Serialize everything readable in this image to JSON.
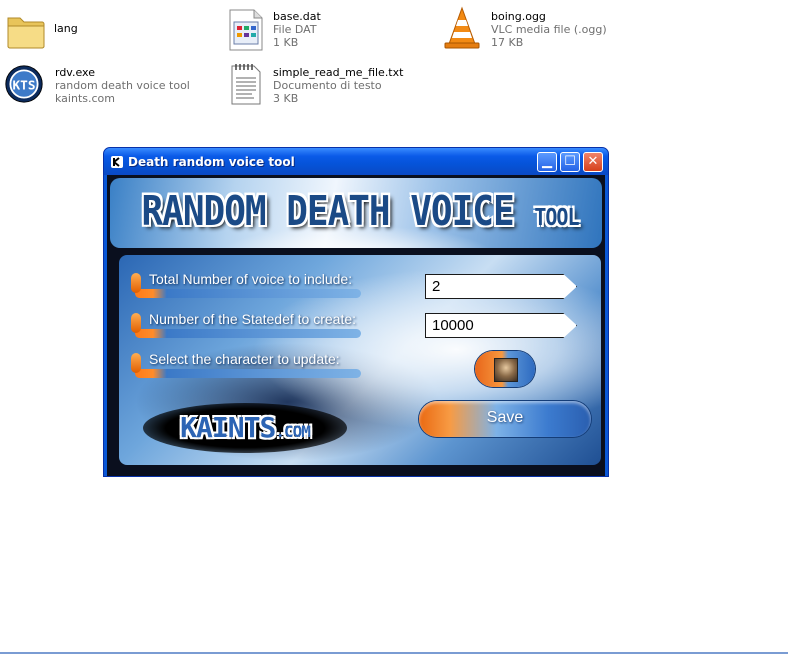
{
  "explorer": {
    "files": [
      {
        "id": "lang",
        "name": "lang",
        "type": "",
        "size": "",
        "icon": "folder-icon"
      },
      {
        "id": "base",
        "name": "base.dat",
        "type": "File DAT",
        "size": "1 KB",
        "icon": "dat-file-icon"
      },
      {
        "id": "boing",
        "name": "boing.ogg",
        "type": "VLC media file (.ogg)",
        "size": "17 KB",
        "icon": "vlc-cone-icon"
      },
      {
        "id": "rdv",
        "name": "rdv.exe",
        "type": "random death voice tool",
        "size": "kaints.com",
        "icon": "kaints-app-icon"
      },
      {
        "id": "read",
        "name": "simple_read_me_file.txt",
        "type": "Documento di testo",
        "size": "3 KB",
        "icon": "text-document-icon"
      }
    ]
  },
  "dialog": {
    "title": "Death random voice tool",
    "banner_main": "RANDOM DEATH VOICE",
    "banner_small": "TOOL",
    "labels": {
      "voices": "Total Number of voice to include:",
      "statedef": "Number of the Statedef to create:",
      "character": "Select the character to update:"
    },
    "fields": {
      "voices": "2",
      "statedef": "10000"
    },
    "save_label": "Save",
    "logo_main": "KAINTS",
    "logo_small": ".COM",
    "colors": {
      "titlebar": "#0a5ae8",
      "accent_orange": "#ff7a18",
      "accent_blue": "#3b79c7"
    }
  }
}
